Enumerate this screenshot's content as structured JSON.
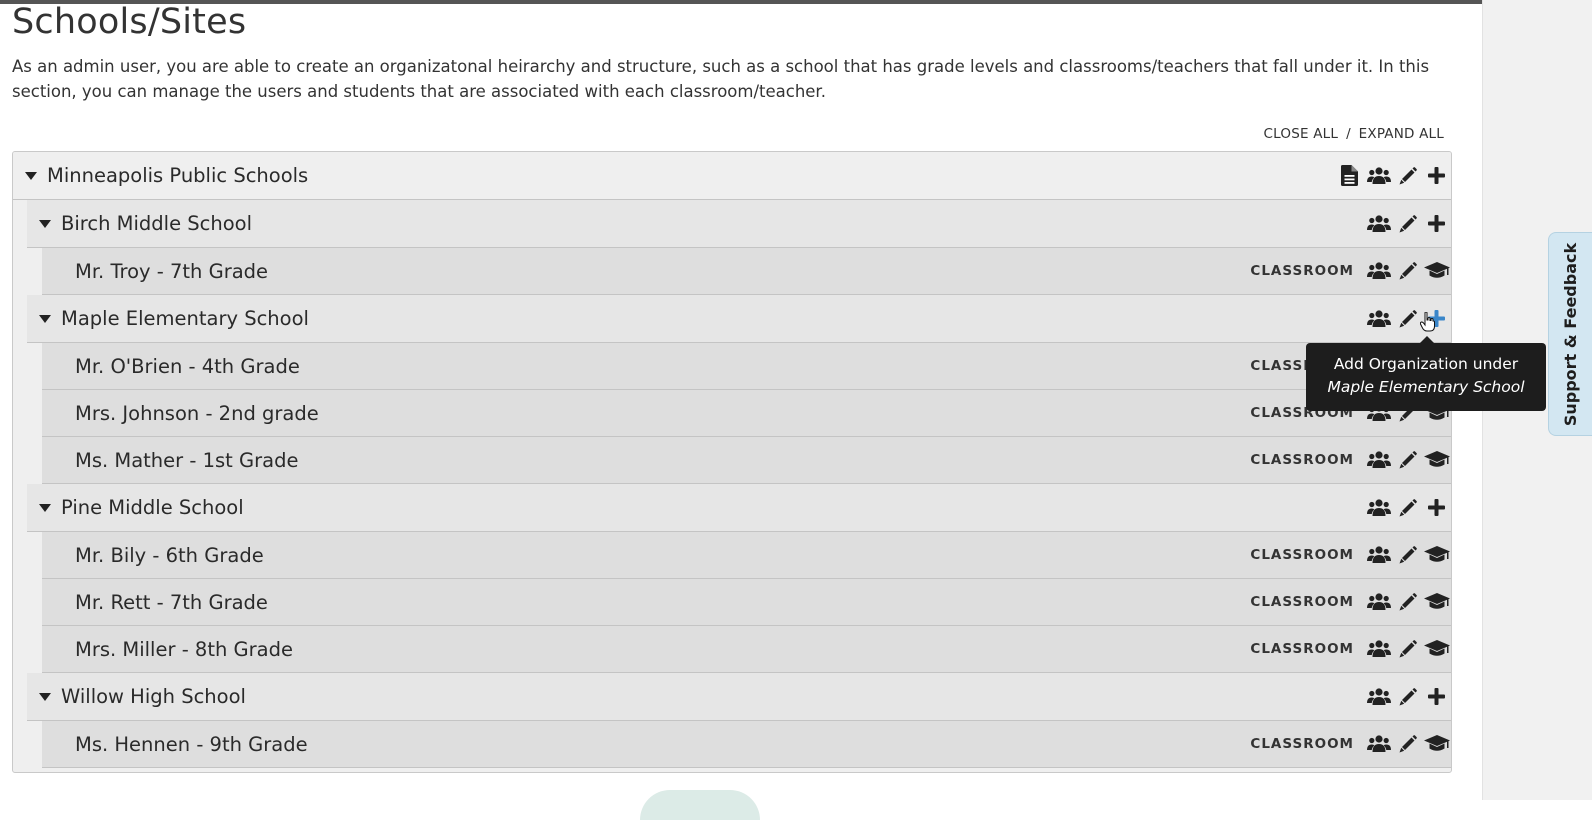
{
  "page": {
    "title": "Schools/Sites",
    "intro": "As an admin user, you are able to create an organizatonal heirarchy and structure, such as a school that has grade levels and classrooms/teachers that fall under it. In this section, you can manage the users and students that are associated with each classroom/teacher."
  },
  "controls": {
    "close_all": "CLOSE ALL",
    "separator": "/",
    "expand_all": "EXPAND ALL"
  },
  "tree": {
    "root": {
      "label": "Minneapolis Public Schools",
      "icons": [
        "document-icon",
        "users-icon",
        "pencil-icon",
        "plus-icon"
      ]
    },
    "schools": [
      {
        "label": "Birch Middle School",
        "classrooms": [
          {
            "label": "Mr. Troy - 7th Grade",
            "badge": "CLASSROOM"
          }
        ]
      },
      {
        "label": "Maple Elementary School",
        "classrooms": [
          {
            "label": "Mr. O'Brien - 4th Grade",
            "badge": "CLASSROOM"
          },
          {
            "label": "Mrs. Johnson - 2nd grade",
            "badge": "CLASSROOM"
          },
          {
            "label": "Ms. Mather - 1st Grade",
            "badge": "CLASSROOM"
          }
        ]
      },
      {
        "label": "Pine Middle School",
        "classrooms": [
          {
            "label": "Mr. Bily - 6th Grade",
            "badge": "CLASSROOM"
          },
          {
            "label": "Mr. Rett - 7th Grade",
            "badge": "CLASSROOM"
          },
          {
            "label": "Mrs. Miller - 8th Grade",
            "badge": "CLASSROOM"
          }
        ]
      },
      {
        "label": "Willow High School",
        "classrooms": [
          {
            "label": "Ms. Hennen - 9th Grade",
            "badge": "CLASSROOM"
          }
        ]
      }
    ]
  },
  "tooltip": {
    "line1": "Add Organization under",
    "line2": "Maple Elementary School"
  },
  "feedback": {
    "label": "Support & Feedback"
  },
  "colors": {
    "accent": "#3a86c9",
    "tooltip_bg": "#1d1d1d",
    "feedback_bg": "#d3e7f2"
  }
}
